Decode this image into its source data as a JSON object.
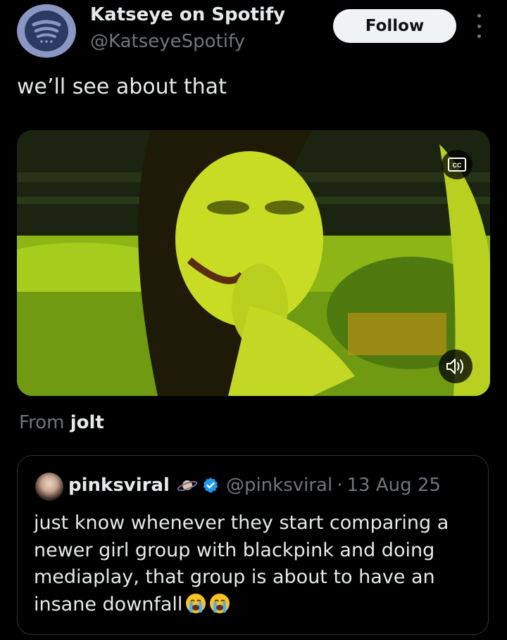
{
  "account": {
    "display_name": "Katseye on Spotify",
    "handle": "@KatseyeSpotify",
    "avatar_icon": "spotify-icon",
    "follow_label": "Follow",
    "more_icon": "more-vertical-icon"
  },
  "post": {
    "text": "we’ll see about that",
    "media": {
      "kind": "video",
      "cc_icon": "closed-captions-icon",
      "volume_icon": "volume-icon"
    },
    "from_prefix": "From",
    "from_source": "jolt"
  },
  "quote": {
    "name": "pinksviral",
    "planet_icon": "planet-icon",
    "verified_icon": "verified-badge-icon",
    "handle": "@pinksviral",
    "separator": "·",
    "date": "13 Aug 25",
    "text_lines": [
      "just know whenever they start comparing a",
      "newer girl group with blackpink and doing",
      "mediaplay, that group is about to have an",
      "insane downfall"
    ],
    "emoji": [
      "😭",
      "😭"
    ]
  },
  "colors": {
    "background": "#000000",
    "text_primary": "#e7e9ea",
    "text_secondary": "#71767b",
    "follow_bg": "#eff3f4",
    "verified_blue": "#1d9bf0",
    "border": "#2f3336"
  }
}
